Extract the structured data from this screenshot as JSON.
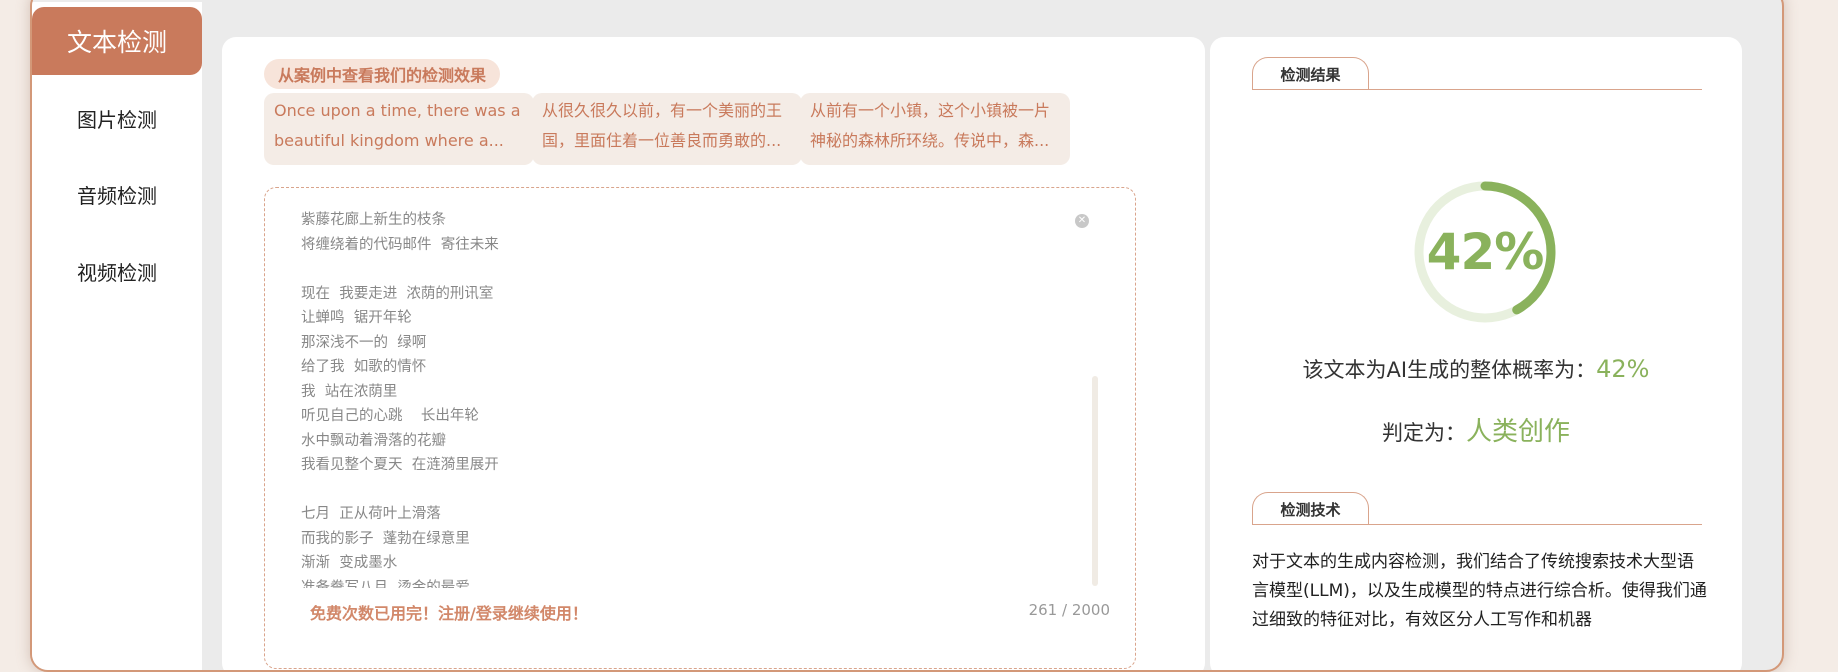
{
  "sidebar": {
    "items": [
      {
        "label": "文本检测",
        "active": true
      },
      {
        "label": "图片检测",
        "active": false
      },
      {
        "label": "音频检测",
        "active": false
      },
      {
        "label": "视频检测",
        "active": false
      }
    ]
  },
  "examples": {
    "title": "从案例中查看我们的检测效果",
    "cards": [
      "Once upon a time, there was a beautiful kingdom where a...",
      "从很久很久以前，有一个美丽的王国，里面住着一位善良而勇敢的...",
      "从前有一个小镇，这个小镇被一片神秘的森林所环绕。传说中，森..."
    ]
  },
  "editor": {
    "text": "紫藤花廊上新生的枝条\n将缠绕着的代码邮件  寄往未来\n\n现在  我要走进  浓荫的刑讯室\n让蝉鸣  锯开年轮\n那深浅不一的  绿啊\n给了我  如歌的情怀\n我  站在浓荫里\n听见自己的心跳    长出年轮\n水中飘动着滑落的花瓣\n我看见整个夏天  在涟漪里展开\n\n七月  正从荷叶上滑落\n而我的影子  蓬勃在绿意里\n渐渐  变成墨水\n准备誊写八月  烫金的最爱",
    "warning": "免费次数已用完！注册/登录继续使用！",
    "counter": "261 / 2000",
    "clear_icon": "close-circle-icon"
  },
  "result": {
    "section_label": "检测结果",
    "percent_text": "42%",
    "probability": 0.42,
    "prob_label": "该文本为AI生成的整体概率为：",
    "prob_value": "42%",
    "verdict_label": "判定为：",
    "verdict_value": "人类创作",
    "accent_color": "#8ab25c",
    "track_color": "#e8f0de"
  },
  "technology": {
    "section_label": "检测技术",
    "text": "对于文本的生成内容检测，我们结合了传统搜索技术大型语言模型(LLM)，以及生成模型的特点进行综合析。使得我们通过细致的特征对比，有效区分人工写作和机器"
  },
  "colors": {
    "brand": "#c97a5c",
    "brand_light": "#f7e4da",
    "card_bg": "#f4ece6"
  }
}
